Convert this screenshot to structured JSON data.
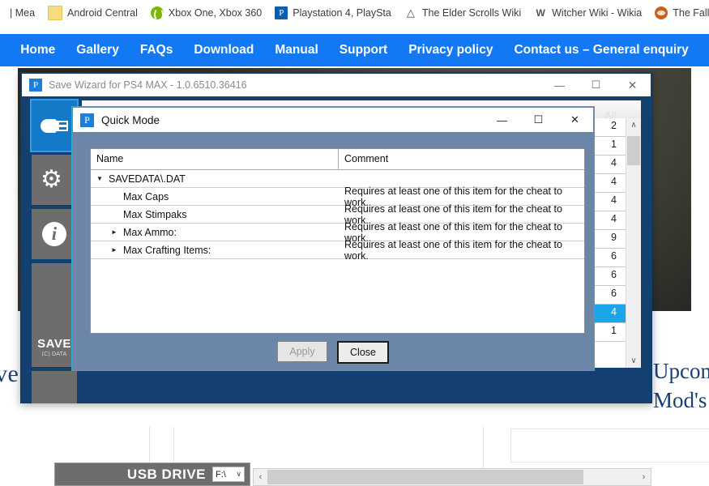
{
  "browser": {
    "bookmarks": [
      {
        "label": "| Mea",
        "icon": "partial-bookmark-icon"
      },
      {
        "label": "Android Central",
        "icon": "folder-icon"
      },
      {
        "label": "Xbox One, Xbox 360",
        "icon": "xbox-icon"
      },
      {
        "label": "Playstation 4, PlaySta",
        "icon": "playstation-icon"
      },
      {
        "label": "The Elder Scrolls Wiki",
        "icon": "elder-scrolls-icon"
      },
      {
        "label": "Witcher Wiki - Wikia",
        "icon": "witcher-icon"
      },
      {
        "label": "The Fallout w",
        "icon": "fallout-icon"
      }
    ]
  },
  "site": {
    "nav": [
      "Home",
      "Gallery",
      "FAQs",
      "Download",
      "Manual",
      "Support",
      "Privacy policy",
      "Contact us – General enquiry"
    ],
    "text_left": "ve",
    "text_right_line1": "Upcom",
    "text_right_line2": "Mod's",
    "nav_bg": "#1278f4"
  },
  "app": {
    "title": "Save Wizard for PS4 MAX - 1.0.6510.36416",
    "icon": "app-logo-icon",
    "window_buttons": {
      "minimize": "—",
      "maximize": "☐",
      "close": "✕"
    },
    "sidebar": [
      {
        "name": "usb-drive",
        "icon": "usb-icon",
        "active": true
      },
      {
        "name": "settings",
        "icon": "gears-icon",
        "active": false
      },
      {
        "name": "about",
        "icon": "info-icon",
        "active": false
      }
    ],
    "logo_line1": "SAVE",
    "logo_line2": "(C) DATA",
    "all_label": "All",
    "list_values": [
      "2",
      "1",
      "4",
      "4",
      "4",
      "4",
      "9",
      "6",
      "6",
      "6",
      "4",
      "1"
    ],
    "selected_index": 10,
    "usb_drive_label": "USB DRIVE",
    "usb_drive_value": "F:\\",
    "usb_drive_arrow": "∨",
    "hscroll_left": "‹",
    "hscroll_right": "›",
    "vscroll_up": "∧",
    "vscroll_down": "∨"
  },
  "quick_mode": {
    "title": "Quick Mode",
    "icon": "app-logo-icon",
    "window_buttons": {
      "minimize": "—",
      "maximize": "☐",
      "close": "✕"
    },
    "columns": [
      "Name",
      "Comment"
    ],
    "rows": [
      {
        "name": "SAVEDATA\\.DAT",
        "comment": "",
        "indent": 0,
        "twisty": "▼"
      },
      {
        "name": "Max Caps",
        "comment": "Requires at least one of this item for the cheat to work.",
        "indent": 1,
        "twisty": ""
      },
      {
        "name": "Max Stimpaks",
        "comment": "Requires at least one of this item for the cheat to work.",
        "indent": 1,
        "twisty": ""
      },
      {
        "name": "Max Ammo:",
        "comment": "Requires at least one of this item for the cheat to work.",
        "indent": 1,
        "twisty": "►"
      },
      {
        "name": "Max Crafting Items:",
        "comment": "Requires at least one of this item for the cheat to work.",
        "indent": 1,
        "twisty": "►"
      }
    ],
    "apply_label": "Apply",
    "close_label": "Close",
    "apply_enabled": false
  }
}
